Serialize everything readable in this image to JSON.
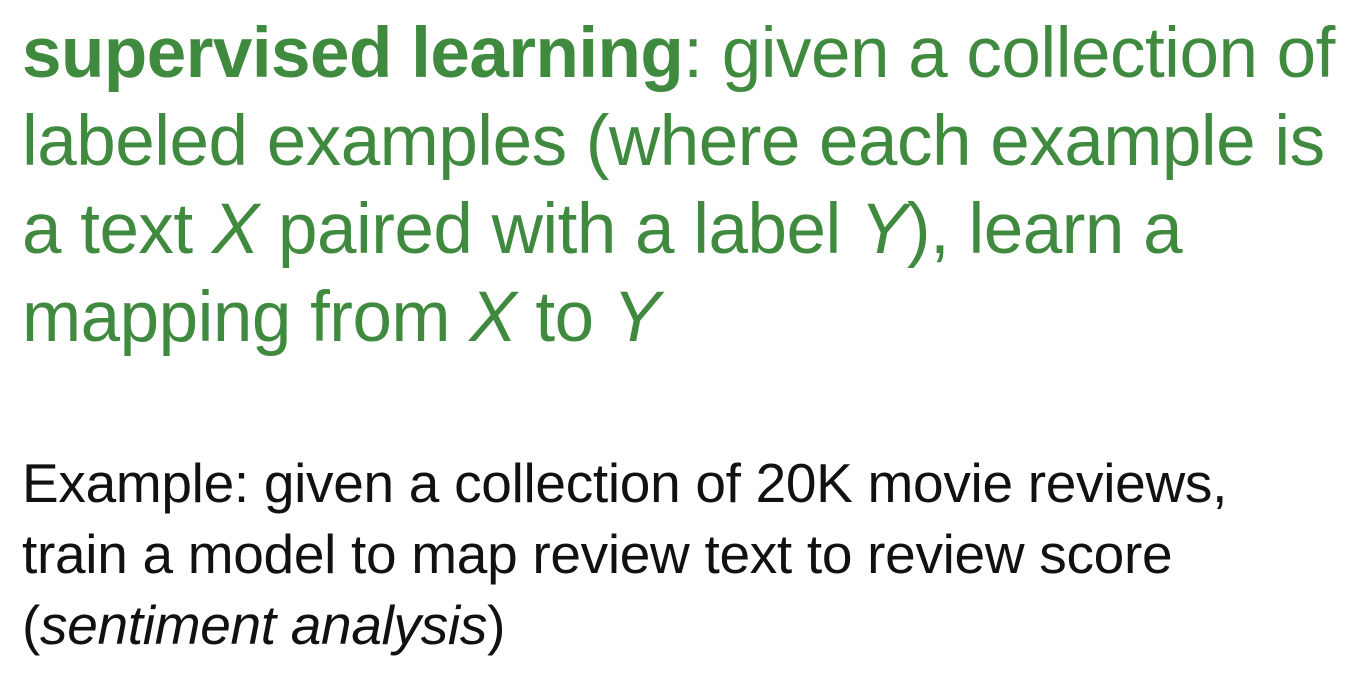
{
  "definition": {
    "term": "supervised learning",
    "colon": ":",
    "part1": " given a collection of labeled examples (where each example is a text ",
    "var_x1": "X",
    "part2": " paired with a label ",
    "var_y1": "Y",
    "part3": "), learn a mapping from ",
    "var_x2": "X",
    "part4": " to ",
    "var_y2": "Y"
  },
  "example": {
    "part1": "Example: given a collection of 20K movie reviews, train a model to map review text to review score (",
    "task": "sentiment analysis",
    "part2": ")"
  },
  "colors": {
    "definition_text": "#3f8a3f",
    "example_text": "#111111",
    "background": "#ffffff"
  }
}
